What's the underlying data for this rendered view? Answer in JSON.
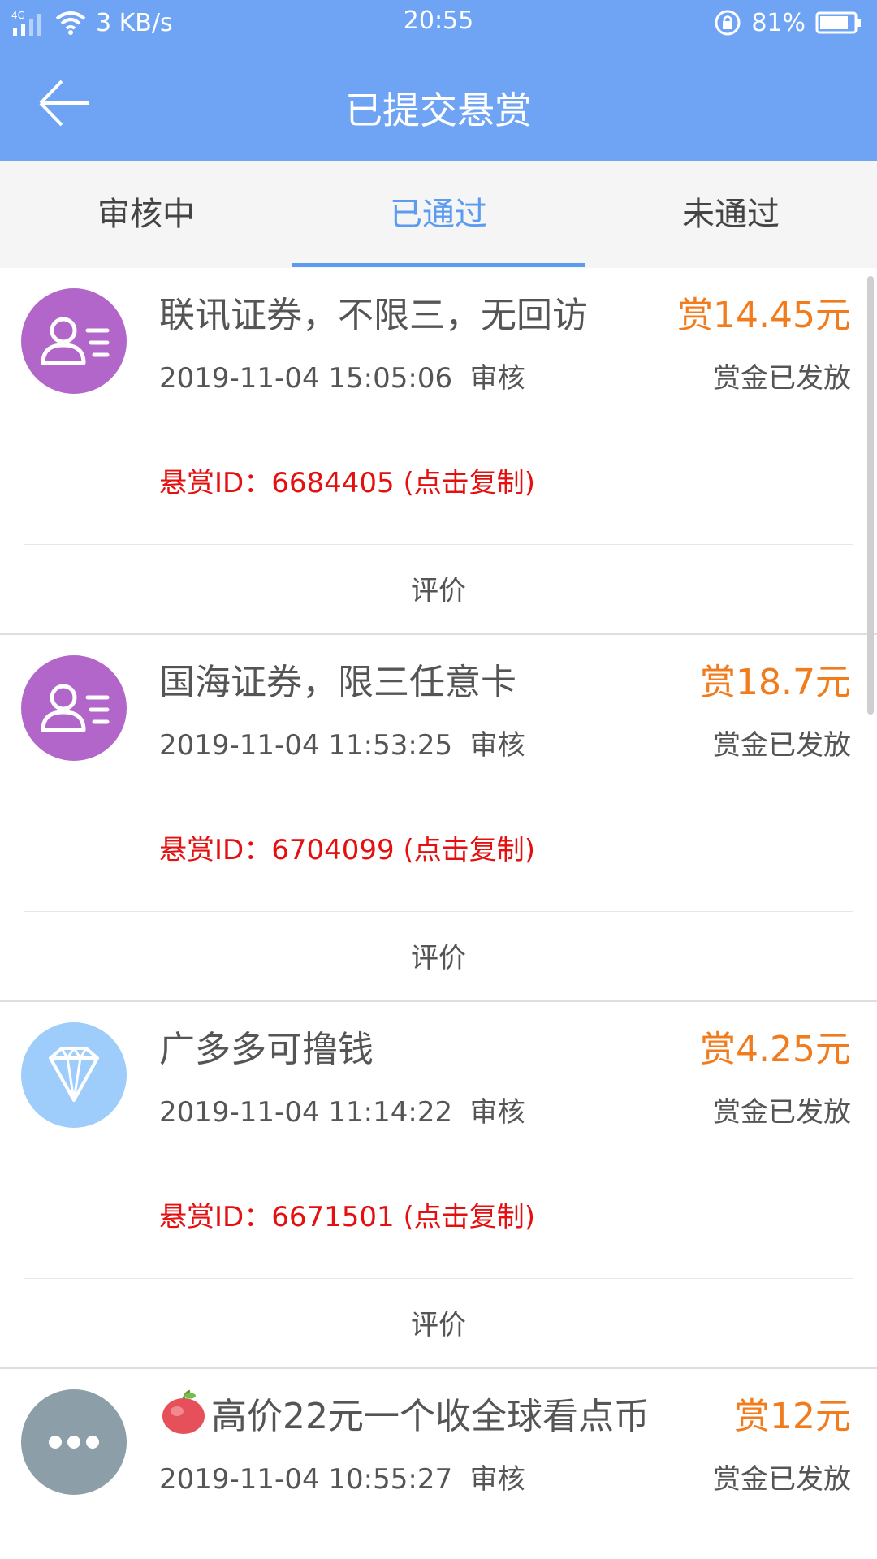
{
  "status_bar": {
    "network": "4G",
    "speed": "3 KB/s",
    "time": "20:55",
    "battery": "81%"
  },
  "header": {
    "title": "已提交悬赏",
    "back_icon": "back-arrow-icon",
    "background": "#6fa4f5"
  },
  "tabs": [
    {
      "label": "审核中",
      "active": false
    },
    {
      "label": "已通过",
      "active": true
    },
    {
      "label": "未通过",
      "active": false
    }
  ],
  "colors": {
    "accent": "#5b9bf0",
    "reward": "#f07c1e",
    "id_text": "#e41010"
  },
  "items": [
    {
      "title": "联讯证券，不限三，无回访",
      "reward": "赏14.45元",
      "date": "2019-11-04 15:05:06",
      "stage": "审核",
      "status": "赏金已发放",
      "id_line": "悬赏ID：6684405 (点击复制)",
      "action": "评价",
      "icon": "contact-card-icon"
    },
    {
      "title": "国海证券，限三任意卡",
      "reward": "赏18.7元",
      "date": "2019-11-04 11:53:25",
      "stage": "审核",
      "status": "赏金已发放",
      "id_line": "悬赏ID：6704099 (点击复制)",
      "action": "评价",
      "icon": "contact-card-icon"
    },
    {
      "title": "广多多可撸钱",
      "reward": "赏4.25元",
      "date": "2019-11-04 11:14:22",
      "stage": "审核",
      "status": "赏金已发放",
      "id_line": "悬赏ID：6671501 (点击复制)",
      "action": "评价",
      "icon": "diamond-icon"
    },
    {
      "title": "高价22元一个收全球看点币",
      "reward": "赏12元",
      "date": "2019-11-04 10:55:27",
      "stage": "审核",
      "status": "赏金已发放",
      "icon": "more-dots-icon",
      "title_emoji": "apple-emoji-icon"
    }
  ]
}
